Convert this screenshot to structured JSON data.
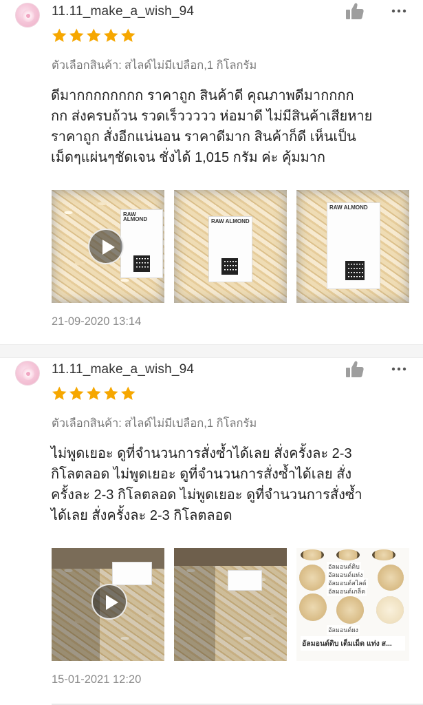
{
  "reviews": [
    {
      "username": "11.11_make_a_wish_94",
      "rating": 5,
      "variation_label": "ตัวเลือกสินค้า:",
      "variation_value": "สไลด์ไม่มีเปลือก,1 กิโลกรัม",
      "text_lines": [
        "ดีมากกกกกกกก ราคาถูก สินค้าดี คุณภาพดีมากกกก",
        "กก ส่งครบถ้วน รวดเร็ววววว ห่อมาดี ไม่มีสินค้าเสียหาย",
        "ราคาถูก สั่งอีกแน่นอน ราคาดีมาก สินค้าก็ดี เห็นเป็น",
        "เม็ดๆแผ่นๆชัดเจน ชั่งได้ 1,015 กรัม ค่ะ คุ้มมาก"
      ],
      "media": [
        {
          "type": "video",
          "label_brand": "RAW ALMOND"
        },
        {
          "type": "image",
          "label_brand": "RAW ALMOND"
        },
        {
          "type": "image",
          "label_brand": "RAW ALMOND"
        }
      ],
      "timestamp": "21-09-2020 13:14"
    },
    {
      "username": "11.11_make_a_wish_94",
      "rating": 5,
      "variation_label": "ตัวเลือกสินค้า:",
      "variation_value": "สไลด์ไม่มีเปลือก,1 กิโลกรัม",
      "text_lines": [
        "ไม่พูดเยอะ ดูที่จำนวนการสั่งซ้ำได้เลย สั่งครั้งละ 2-3",
        "กิโลตลอด ไม่พูดเยอะ ดูที่จำนวนการสั่งซ้ำได้เลย สั่ง",
        "ครั้งละ 2-3 กิโลตลอด ไม่พูดเยอะ ดูที่จำนวนการสั่งซ้ำ",
        "ได้เลย สั่งครั้งละ 2-3 กิโลตลอด"
      ],
      "media": [
        {
          "type": "video"
        },
        {
          "type": "image"
        },
        {
          "type": "image",
          "ad_labels": [
            "อัลมอนด์ดิบ",
            "อัลมอนด์แท่ง",
            "อัลมอนด์สไลด์",
            "อัลมอนด์เกล็ด",
            "อัลมอนด์ผง"
          ],
          "caption": "อัลมอนด์ดิบ เต็มเม็ด แท่ง ส..."
        }
      ],
      "timestamp": "15-01-2021 12:20"
    }
  ],
  "icons": {
    "like": "thumbs-up-icon",
    "more": "more-dots-icon",
    "star": "star-icon",
    "play": "play-icon"
  },
  "colors": {
    "star": "#f6a700",
    "icon_gray": "#9e9e9e",
    "muted_text": "#777777",
    "timestamp": "#8a8a8a"
  }
}
